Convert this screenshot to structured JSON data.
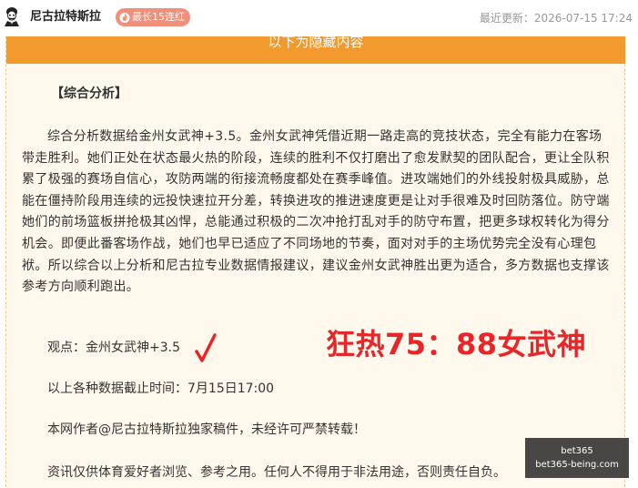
{
  "header": {
    "author_name": "尼古拉特斯拉",
    "streak_badge": "最长15连红",
    "updated": "最近更新：2026-07-15 17:24",
    "avatar_icon": "portrait-avatar-icon",
    "badge_icon": "fire-icon"
  },
  "content": {
    "hidden_banner": "以下为隐藏内容",
    "section_title": "【综合分析】",
    "analysis": "综合分析数据给金州女武神+3.5。金州女武神凭借近期一路走高的竞技状态，完全有能力在客场带走胜利。她们正处在状态最火热的阶段，连续的胜利不仅打磨出了愈发默契的团队配合，更让全队积累了极强的赛场自信心，攻防两端的衔接流畅度都处在赛季峰值。进攻端她们的外线投射极具威胁，总能在僵持阶段用连续的远投快速拉开分差，转换进攻的推进速度更是让对手很难及时回防落位。防守端她们的前场篮板拼抢极其凶悍，总能通过积极的二次冲抢打乱对手的防守布置，把更多球权转化为得分机会。即便此番客场作战，她们也早已适应了不同场地的节奏，面对对手的主场优势完全没有心理包袱。所以综合以上分析和尼古拉专业数据情报建议，建议金州女武神胜出更为适合，多方数据也支撑该参考方向顺利跑出。",
    "pick": "观点：金州女武神+3.5",
    "headline": "狂热75：88女武神",
    "cutoff": "以上各种数据截止时间：7月15日17:00",
    "copyright": "本网作者@尼古拉特斯拉独家稿件，未经许可严禁转载！",
    "disclaimer": "资讯仅供体育爱好者浏览、参考之用。任何人不得用于非法用途，否则责任自负。"
  },
  "watermark": {
    "line1": "bet365",
    "line2": "bet365-being.com"
  },
  "colors": {
    "banner": "#f29a2e",
    "badge": "#f08f7a",
    "headline": "#e8262a",
    "content_bg": "#fff8ec"
  }
}
